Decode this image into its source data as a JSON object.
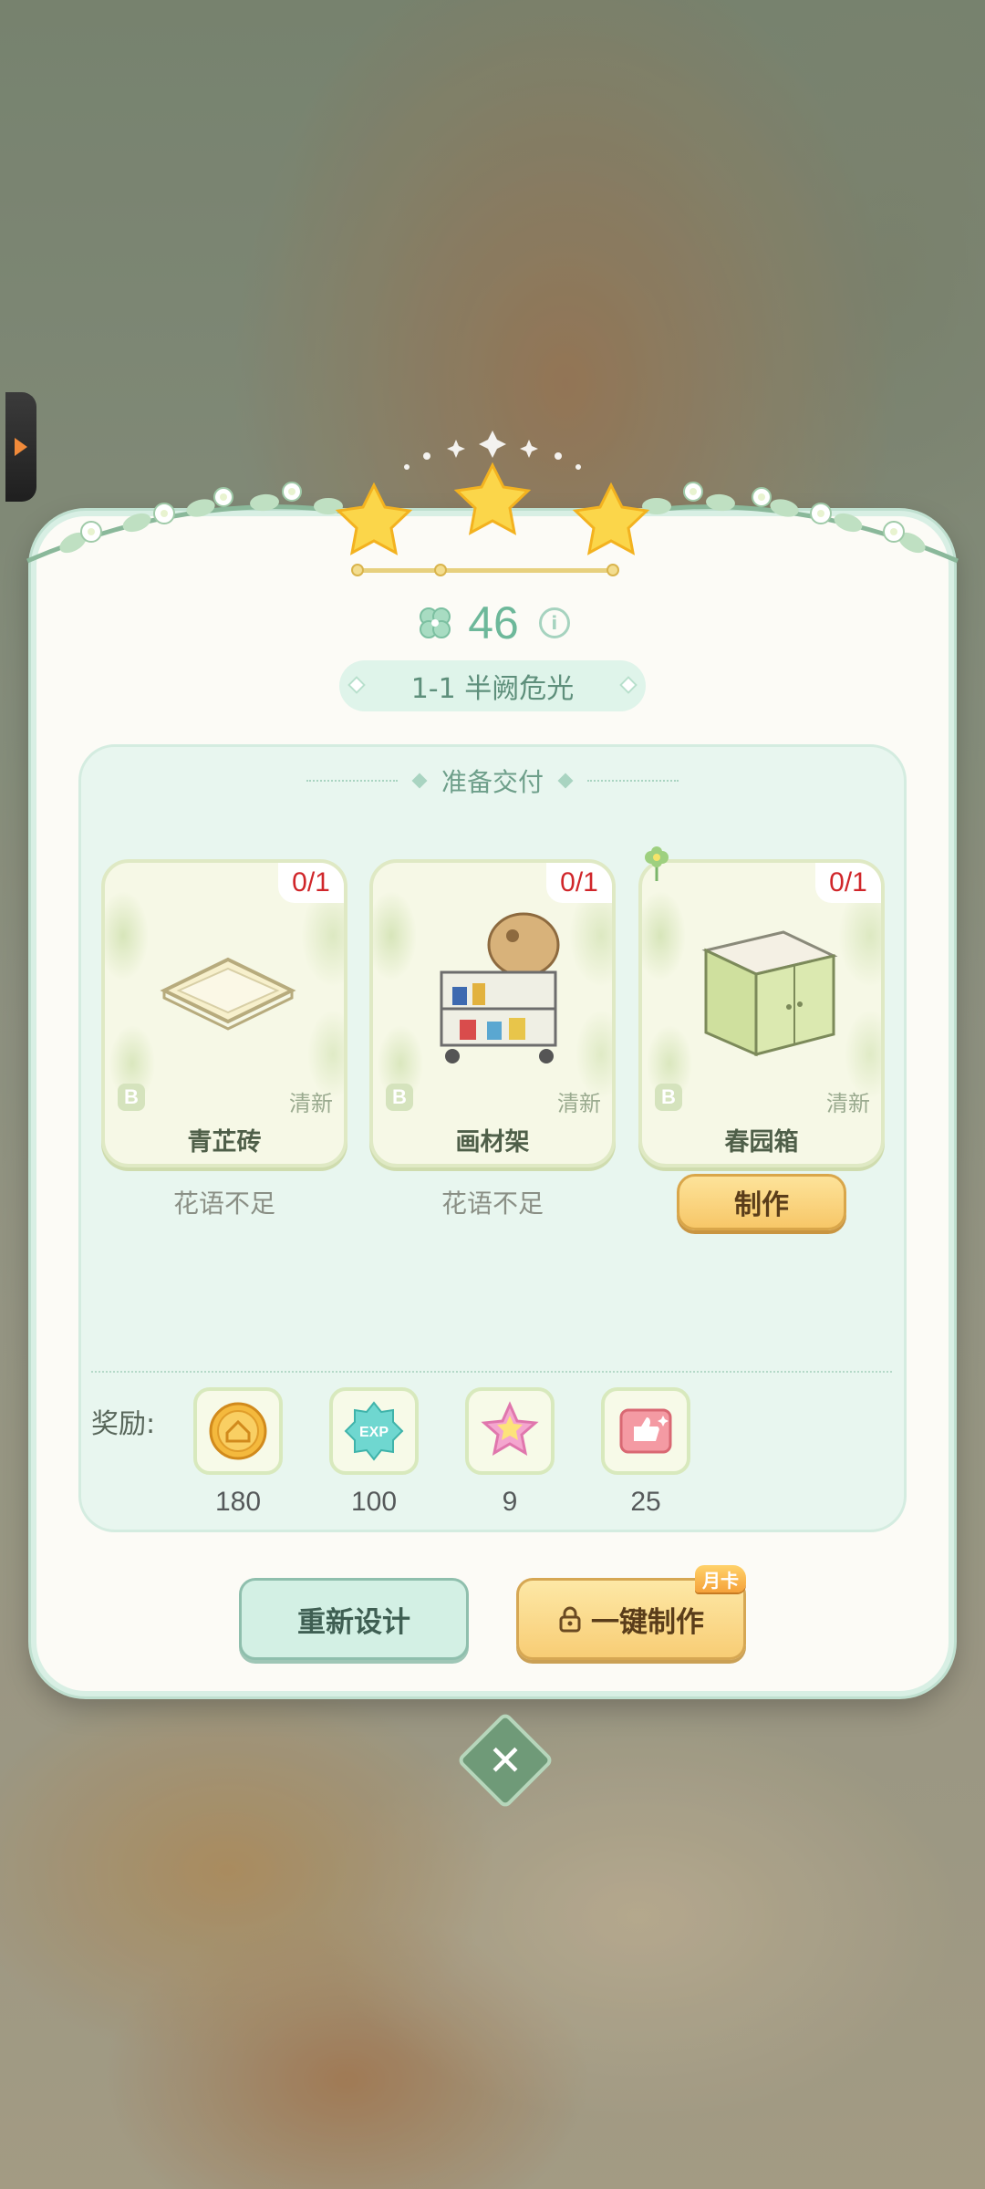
{
  "score": {
    "value": "46"
  },
  "level": {
    "label": "1-1  半阙危光"
  },
  "section": {
    "title": "准备交付"
  },
  "items": [
    {
      "name": "青芷砖",
      "count": "0/1",
      "grade": "B",
      "style": "清新",
      "status": "花语不足"
    },
    {
      "name": "画材架",
      "count": "0/1",
      "grade": "B",
      "style": "清新",
      "status": "花语不足"
    },
    {
      "name": "春园箱",
      "count": "0/1",
      "grade": "B",
      "style": "清新",
      "action": "制作"
    }
  ],
  "rewards": {
    "label": "奖励:",
    "list": [
      {
        "icon": "coin-icon",
        "value": "180"
      },
      {
        "icon": "exp-icon",
        "value": "100",
        "text": "EXP"
      },
      {
        "icon": "star-icon",
        "value": "9"
      },
      {
        "icon": "thumbs-up-card-icon",
        "value": "25"
      }
    ]
  },
  "buttons": {
    "redesign": "重新设计",
    "oneclick": "一键制作",
    "monthly_badge": "月卡"
  },
  "stars_earned": 3,
  "colors": {
    "accent_green": "#6db89a",
    "count_red": "#d0262a",
    "button_gold": "#f8cd75"
  }
}
